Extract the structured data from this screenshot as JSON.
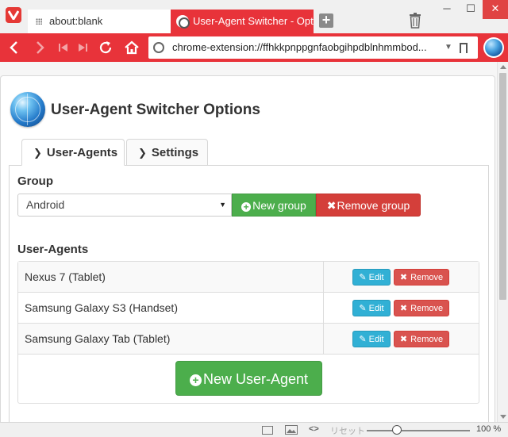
{
  "browser": {
    "tabs": [
      {
        "label": "about:blank",
        "active": false
      },
      {
        "label": "User-Agent Switcher - Optio",
        "active": true
      }
    ],
    "url": "chrome-extension://ffhkkpnppgnfaobgihpdblnhmmbod...",
    "window_controls": {
      "minimize": "─",
      "maximize": "☐",
      "close": "✕"
    },
    "accent_color": "#e8333a"
  },
  "page": {
    "title": "User-Agent Switcher Options",
    "tabs": [
      {
        "label": "User-Agents",
        "active": true
      },
      {
        "label": "Settings",
        "active": false
      }
    ],
    "group_label": "Group",
    "group_selected": "Android",
    "new_group_label": "New group",
    "remove_group_label": "Remove group",
    "user_agents_label": "User-Agents",
    "user_agents": [
      {
        "name": "Nexus 7 (Tablet)"
      },
      {
        "name": "Samsung Galaxy S3 (Handset)"
      },
      {
        "name": "Samsung Galaxy Tab (Tablet)"
      }
    ],
    "edit_label": "Edit",
    "remove_label": "Remove",
    "new_user_agent_label": "New User-Agent"
  },
  "statusbar": {
    "reset_label": "リセット",
    "zoom": "100 %",
    "zoom_fraction": 0.25,
    "code_label": "<>"
  }
}
